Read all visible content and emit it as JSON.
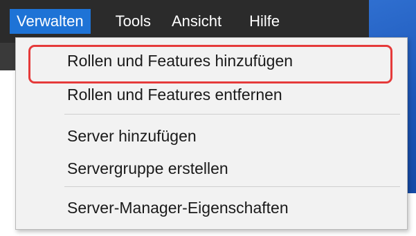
{
  "menubar": {
    "items": [
      "Verwalten",
      "Tools",
      "Ansicht",
      "Hilfe"
    ]
  },
  "dropdown": {
    "items": [
      "Rollen und Features hinzufügen",
      "Rollen und Features entfernen",
      "Server hinzufügen",
      "Servergruppe erstellen",
      "Server-Manager-Eigenschaften"
    ]
  },
  "colors": {
    "menubar_bg": "#2b2b2b",
    "active_menu_bg": "#1e73d6",
    "highlight_border": "#e53a3a",
    "dropdown_bg": "#f2f2f2"
  }
}
